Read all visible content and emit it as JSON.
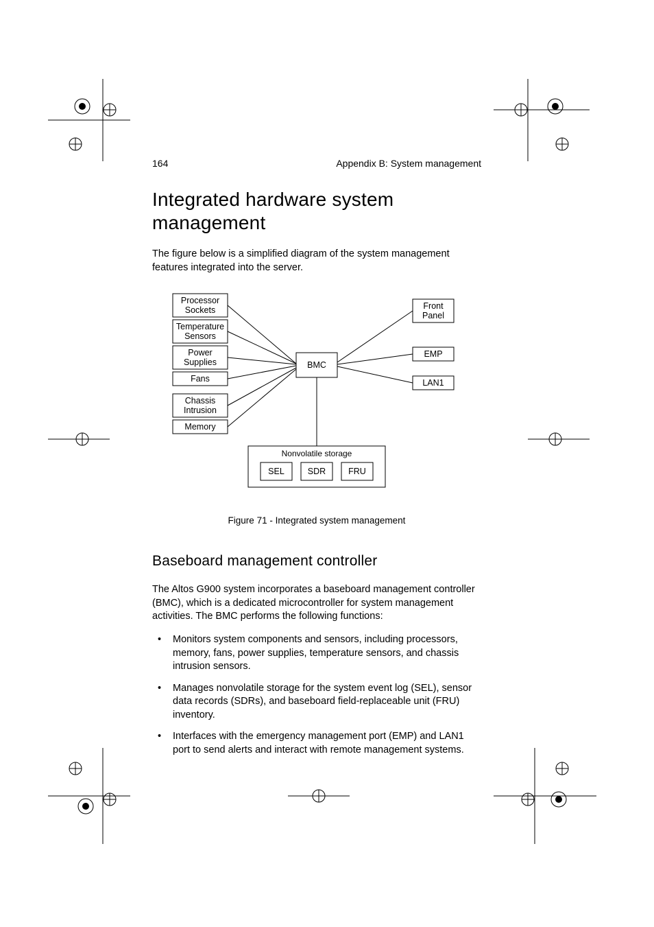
{
  "header": {
    "page_number": "164",
    "appendix": "Appendix B: System management"
  },
  "title": "Integrated hardware system management",
  "intro": "The figure below is a simplified diagram of the system management features integrated into the server.",
  "diagram": {
    "left_boxes": [
      "Processor Sockets",
      "Temperature Sensors",
      "Power Supplies",
      "Fans",
      "Chassis Intrusion",
      "Memory"
    ],
    "center": "BMC",
    "right_boxes": [
      "Front Panel",
      "EMP",
      "LAN1"
    ],
    "storage_label": "Nonvolatile storage",
    "storage_boxes": [
      "SEL",
      "SDR",
      "FRU"
    ]
  },
  "caption": "Figure 71 - Integrated system management",
  "subtitle": "Baseboard management controller",
  "body": "The Altos G900 system incorporates a baseboard management controller (BMC), which is a dedicated microcontroller for system management activities.  The BMC performs the following functions:",
  "bullets": [
    "Monitors system components and sensors, including processors, memory, fans, power supplies, temperature sensors, and chassis intrusion sensors.",
    "Manages nonvolatile storage for the system event log (SEL), sensor data records (SDRs), and baseboard field-replaceable unit (FRU) inventory.",
    "Interfaces with the emergency management port (EMP) and LAN1 port to send alerts and interact with remote management systems."
  ]
}
